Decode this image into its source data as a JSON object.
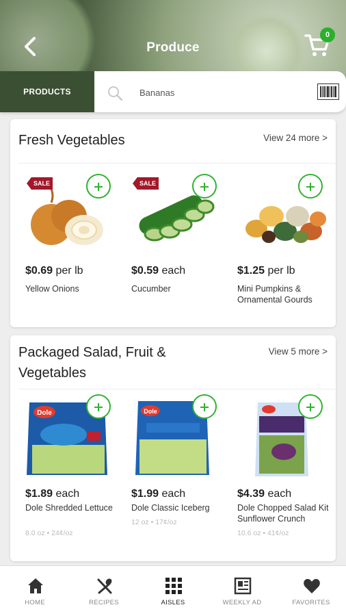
{
  "header": {
    "title": "Produce",
    "cart_count": "0"
  },
  "search": {
    "tab_label": "PRODUCTS",
    "placeholder": "Bananas"
  },
  "sections": [
    {
      "title": "Fresh Vegetables",
      "view_more": "View 24 more >",
      "products": [
        {
          "price": "$0.69",
          "unit": " per lb",
          "name": "Yellow Onions",
          "sale": "SALE",
          "image": "onion-image"
        },
        {
          "price": "$0.59",
          "unit": " each",
          "name": "Cucumber",
          "sale": "SALE",
          "image": "cucumber-image"
        },
        {
          "price": "$1.25",
          "unit": " per lb",
          "name": "Mini Pumpkins & Ornamental Gourds",
          "image": "pumpkins-image"
        }
      ]
    },
    {
      "title": "Packaged Salad, Fruit & Vegetables",
      "view_more": "View 5 more >",
      "products": [
        {
          "price": "$1.89",
          "unit": " each",
          "name": "Dole Shredded Lettuce",
          "size": "8.0 oz • 24¢/oz",
          "image": "lettuce-bag-image"
        },
        {
          "price": "$1.99",
          "unit": " each",
          "name": "Dole Classic Iceberg",
          "size": "12 oz • 17¢/oz",
          "image": "iceberg-bag-image"
        },
        {
          "price": "$4.39",
          "unit": " each",
          "name": "Dole Chopped Salad Kit Sunflower Crunch",
          "size": "10.6 oz • 41¢/oz",
          "image": "salad-kit-image"
        }
      ]
    }
  ],
  "nav": [
    {
      "label": "HOME",
      "icon": "home-icon"
    },
    {
      "label": "RECIPES",
      "icon": "recipes-icon"
    },
    {
      "label": "AISLES",
      "icon": "aisles-icon",
      "active": true
    },
    {
      "label": "WEEKLY AD",
      "icon": "weekly-ad-icon"
    },
    {
      "label": "FAVORITES",
      "icon": "heart-icon"
    }
  ],
  "colors": {
    "brand_dark": "#3b4f33",
    "add_green": "#2fb32f",
    "sale_red": "#a3182a"
  }
}
